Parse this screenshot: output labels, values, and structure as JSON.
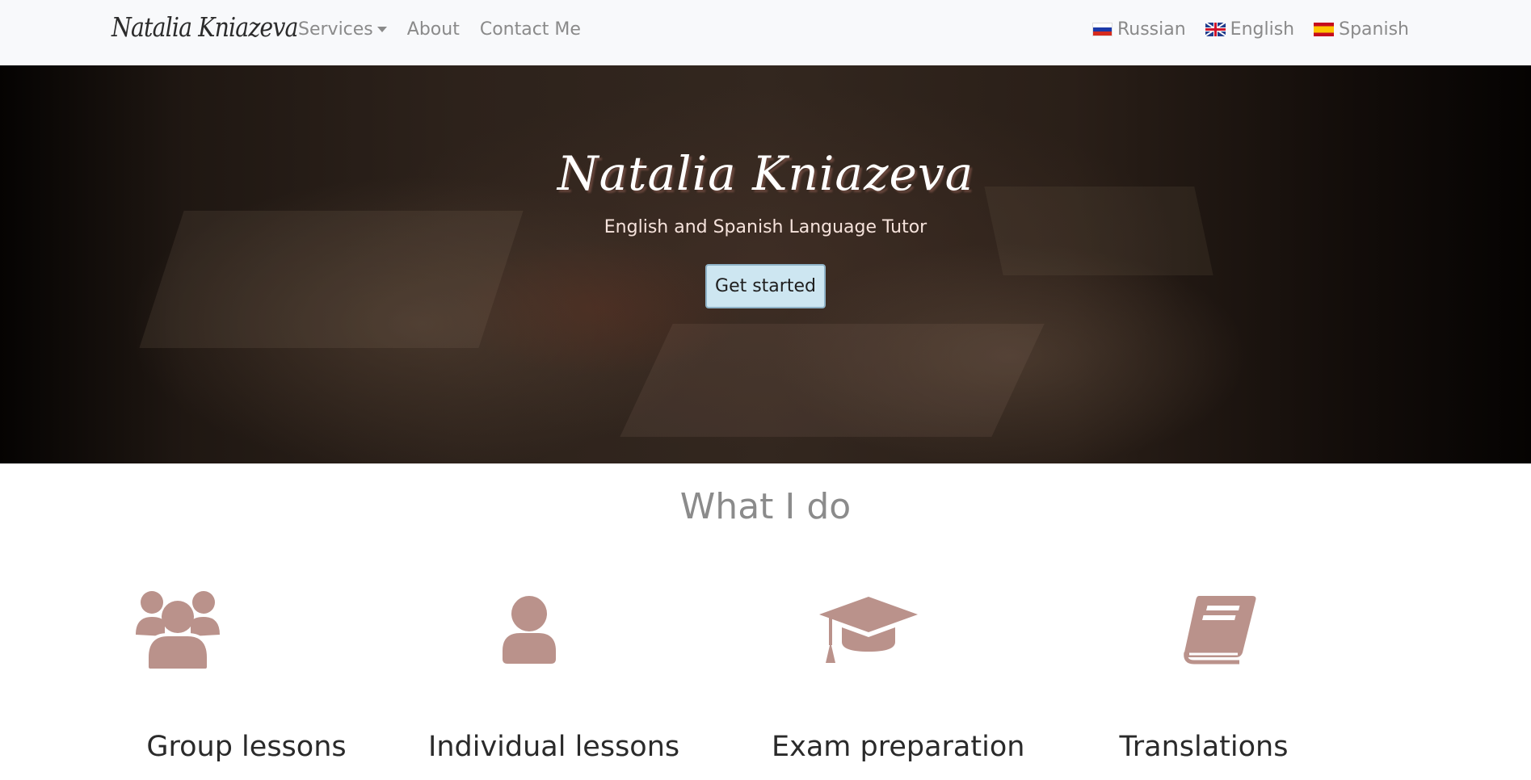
{
  "navbar": {
    "brand": "Natalia Kniazeva",
    "links": {
      "services": "Services",
      "about": "About",
      "contact": "Contact Me"
    },
    "languages": {
      "russian": "Russian",
      "english": "English",
      "spanish": "Spanish"
    }
  },
  "hero": {
    "title": "Natalia Kniazeva",
    "subtitle": "English and Spanish Language Tutor",
    "button": "Get started"
  },
  "services_section": {
    "title": "What I do",
    "items": [
      {
        "label": "Group lessons",
        "icon": "users-icon"
      },
      {
        "label": "Individual lessons",
        "icon": "user-icon"
      },
      {
        "label": "Exam preparation",
        "icon": "graduation-cap-icon"
      },
      {
        "label": "Translations",
        "icon": "book-icon"
      }
    ]
  },
  "colors": {
    "navbar_bg": "#f8f9fb",
    "nav_text": "#8a8a8a",
    "icon_accent": "#ba928b",
    "button_bg": "#cde6f1",
    "hero_subtitle": "#f6e3dc"
  }
}
